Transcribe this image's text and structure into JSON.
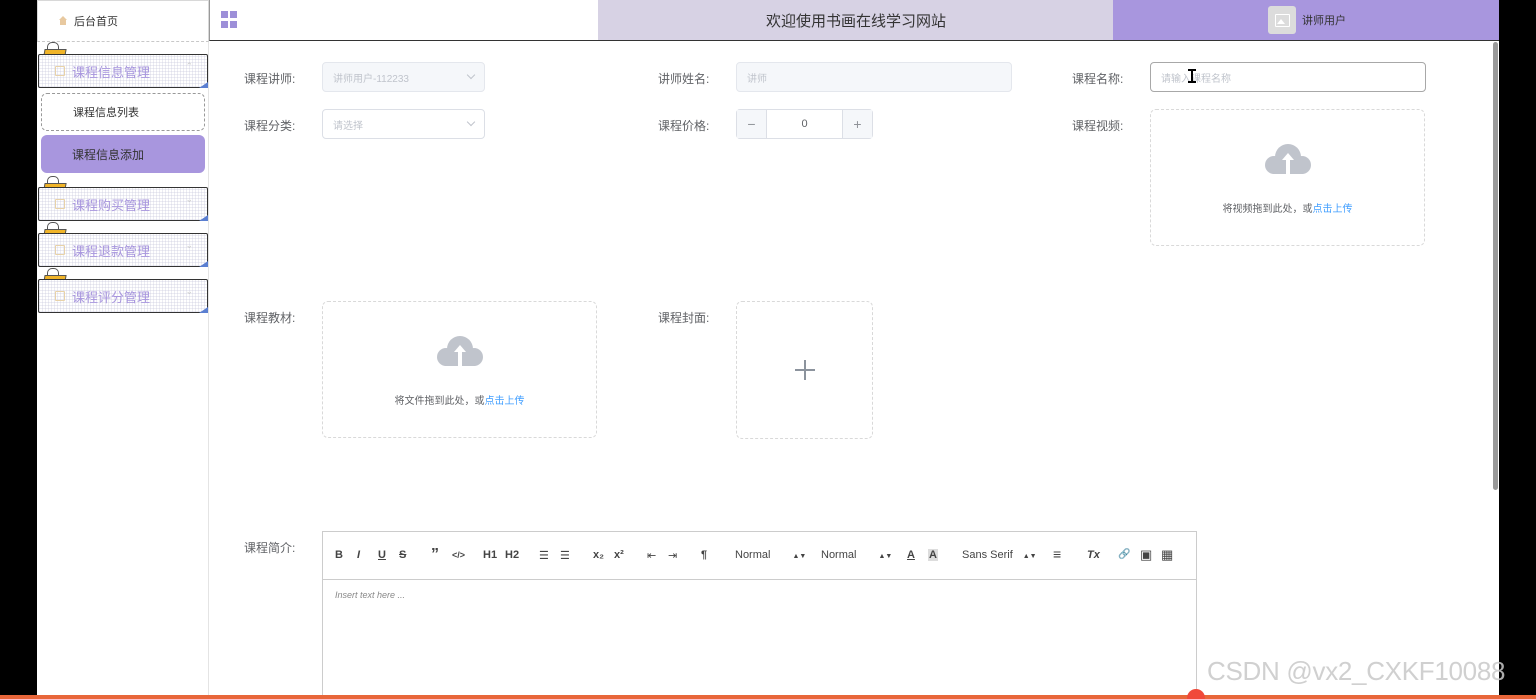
{
  "header": {
    "home_label": "后台首页",
    "welcome_title": "欢迎使用书画在线学习网站",
    "user_label": "讲师用户"
  },
  "sidebar": {
    "groups": [
      {
        "label": "课程信息管理",
        "expanded": true,
        "items": [
          {
            "label": "课程信息列表",
            "active": false
          },
          {
            "label": "课程信息添加",
            "active": true
          }
        ]
      },
      {
        "label": "课程购买管理",
        "expanded": false
      },
      {
        "label": "课程退款管理",
        "expanded": false
      },
      {
        "label": "课程评分管理",
        "expanded": false
      }
    ]
  },
  "form": {
    "teacher": {
      "label": "课程讲师:",
      "value": "讲师用户-112233"
    },
    "teacher_name": {
      "label": "讲师姓名:",
      "value": "讲师"
    },
    "course_name": {
      "label": "课程名称:",
      "placeholder": "请输入课程名称"
    },
    "category": {
      "label": "课程分类:",
      "placeholder": "请选择"
    },
    "price": {
      "label": "课程价格:",
      "value": "0",
      "minus": "−",
      "plus": "+"
    },
    "video": {
      "label": "课程视频:",
      "hint": "将视频拖到此处，或",
      "link": "点击上传"
    },
    "material": {
      "label": "课程教材:",
      "hint": "将文件拖到此处，或",
      "link": "点击上传"
    },
    "cover": {
      "label": "课程封面:"
    },
    "intro": {
      "label": "课程简介:",
      "placeholder": "Insert text here ..."
    }
  },
  "editor_toolbar": {
    "bold": "B",
    "italic": "I",
    "underline": "U",
    "strike": "S",
    "quote": "”",
    "code": "</>",
    "h1": "H1",
    "h2": "H2",
    "ol": "☰",
    "ul": "☰",
    "sub": "x₂",
    "sup": "x²",
    "outdent": "⇤",
    "indent": "⇥",
    "direction": "¶",
    "size": "Normal",
    "header": "Normal",
    "font": "Sans Serif",
    "color": "A",
    "background": "A",
    "align": "≡",
    "clean": "Tx",
    "link": "🔗",
    "image": "▣",
    "video": "▦"
  },
  "watermark": "CSDN @vx2_CXKF10088",
  "colors": {
    "accent": "#a896de",
    "welcome_bg": "#d7d2e4",
    "link": "#409eff"
  }
}
